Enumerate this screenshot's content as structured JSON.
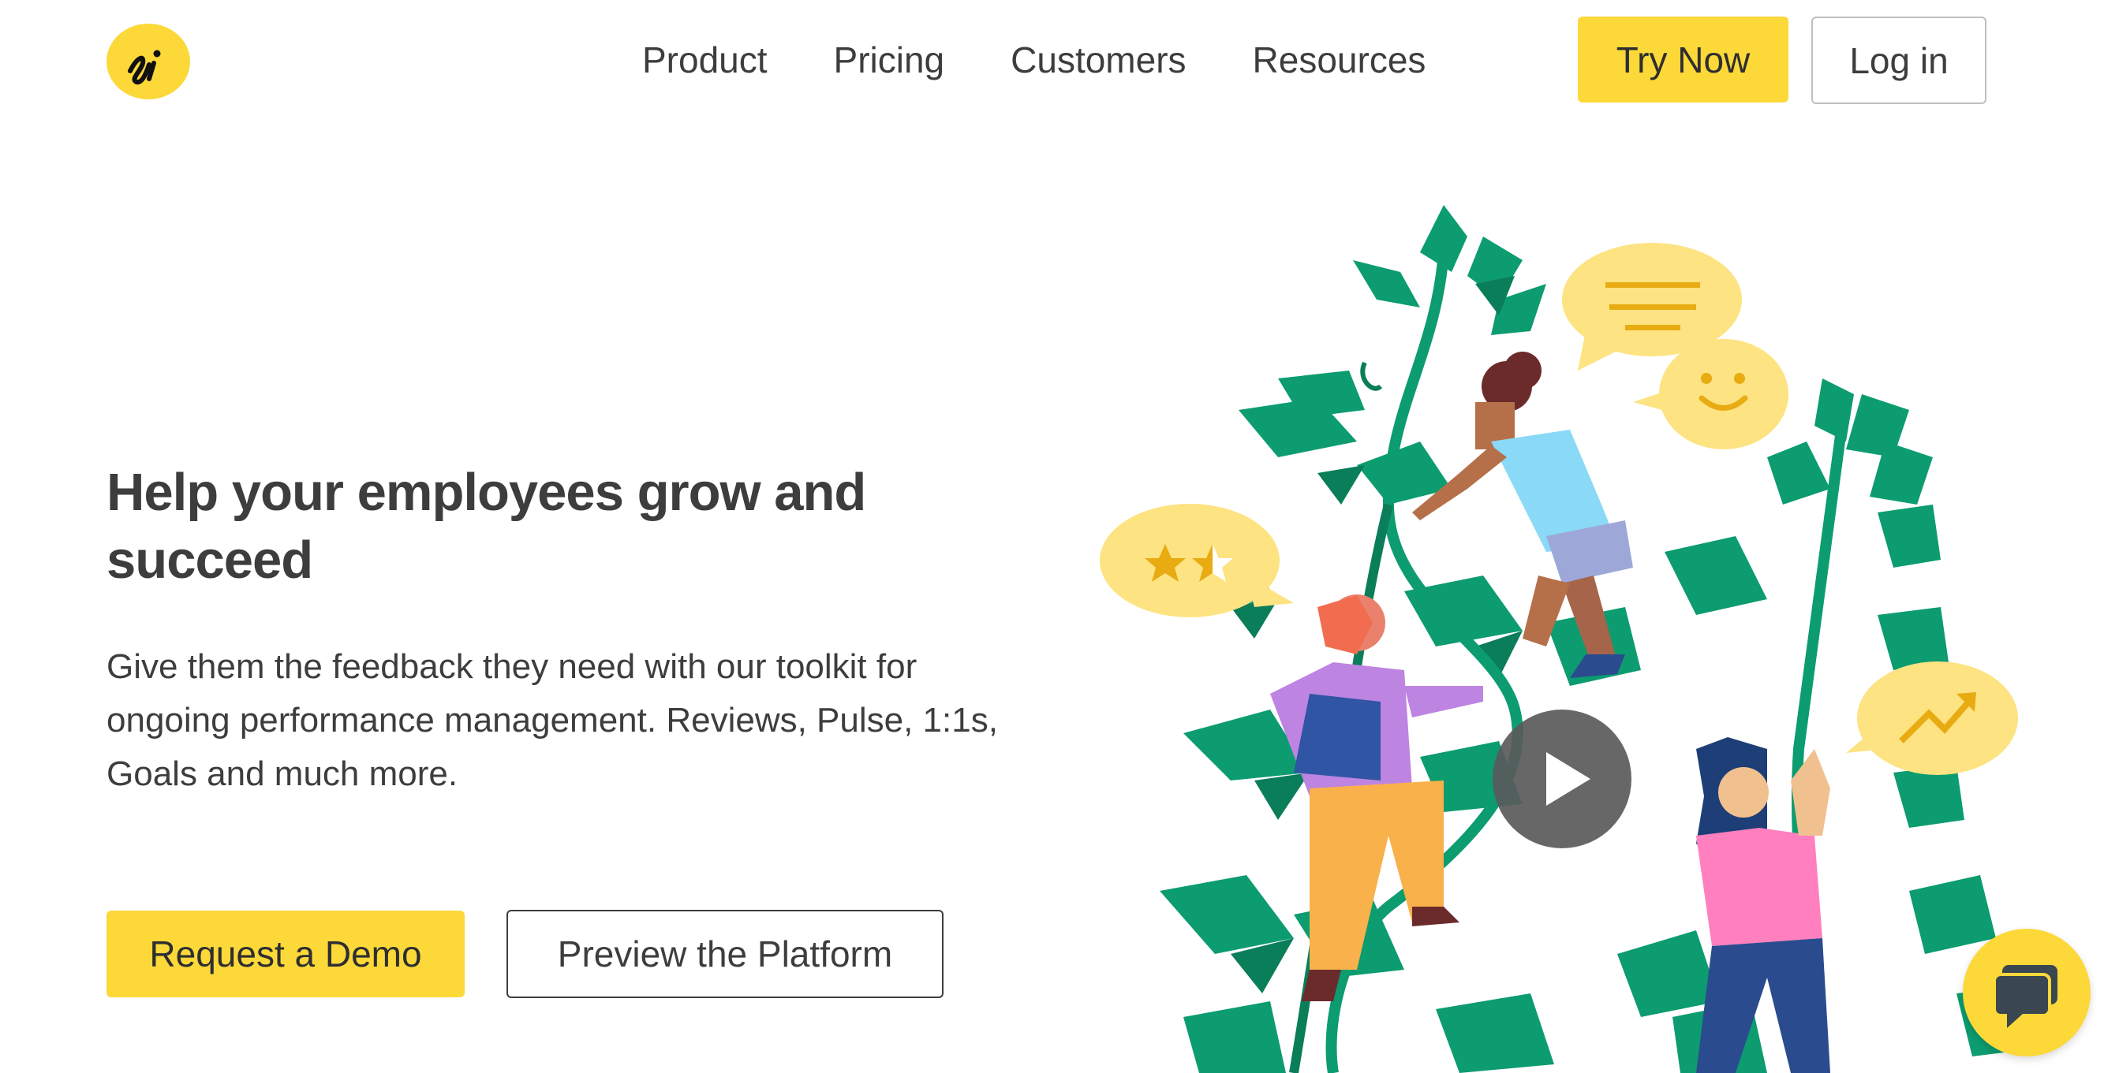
{
  "header": {
    "logo_text": "si",
    "nav": [
      {
        "label": "Product"
      },
      {
        "label": "Pricing"
      },
      {
        "label": "Customers"
      },
      {
        "label": "Resources"
      }
    ],
    "try_now_label": "Try Now",
    "login_label": "Log in"
  },
  "hero": {
    "title": "Help your employees grow and succeed",
    "subtitle": "Give them the feedback they need with our toolkit for ongoing performance management. Reviews, Pulse, 1:1s, Goals and much more.",
    "demo_label": "Request a Demo",
    "preview_label": "Preview the Platform"
  },
  "icons": {
    "logo": "si-logo-icon",
    "play": "play-icon",
    "chat": "chat-bubbles-icon"
  },
  "colors": {
    "accent": "#fcd839",
    "text": "#3d3d3f",
    "leaf": "#0c9c6f",
    "leaf_dark": "#0a7d59"
  }
}
